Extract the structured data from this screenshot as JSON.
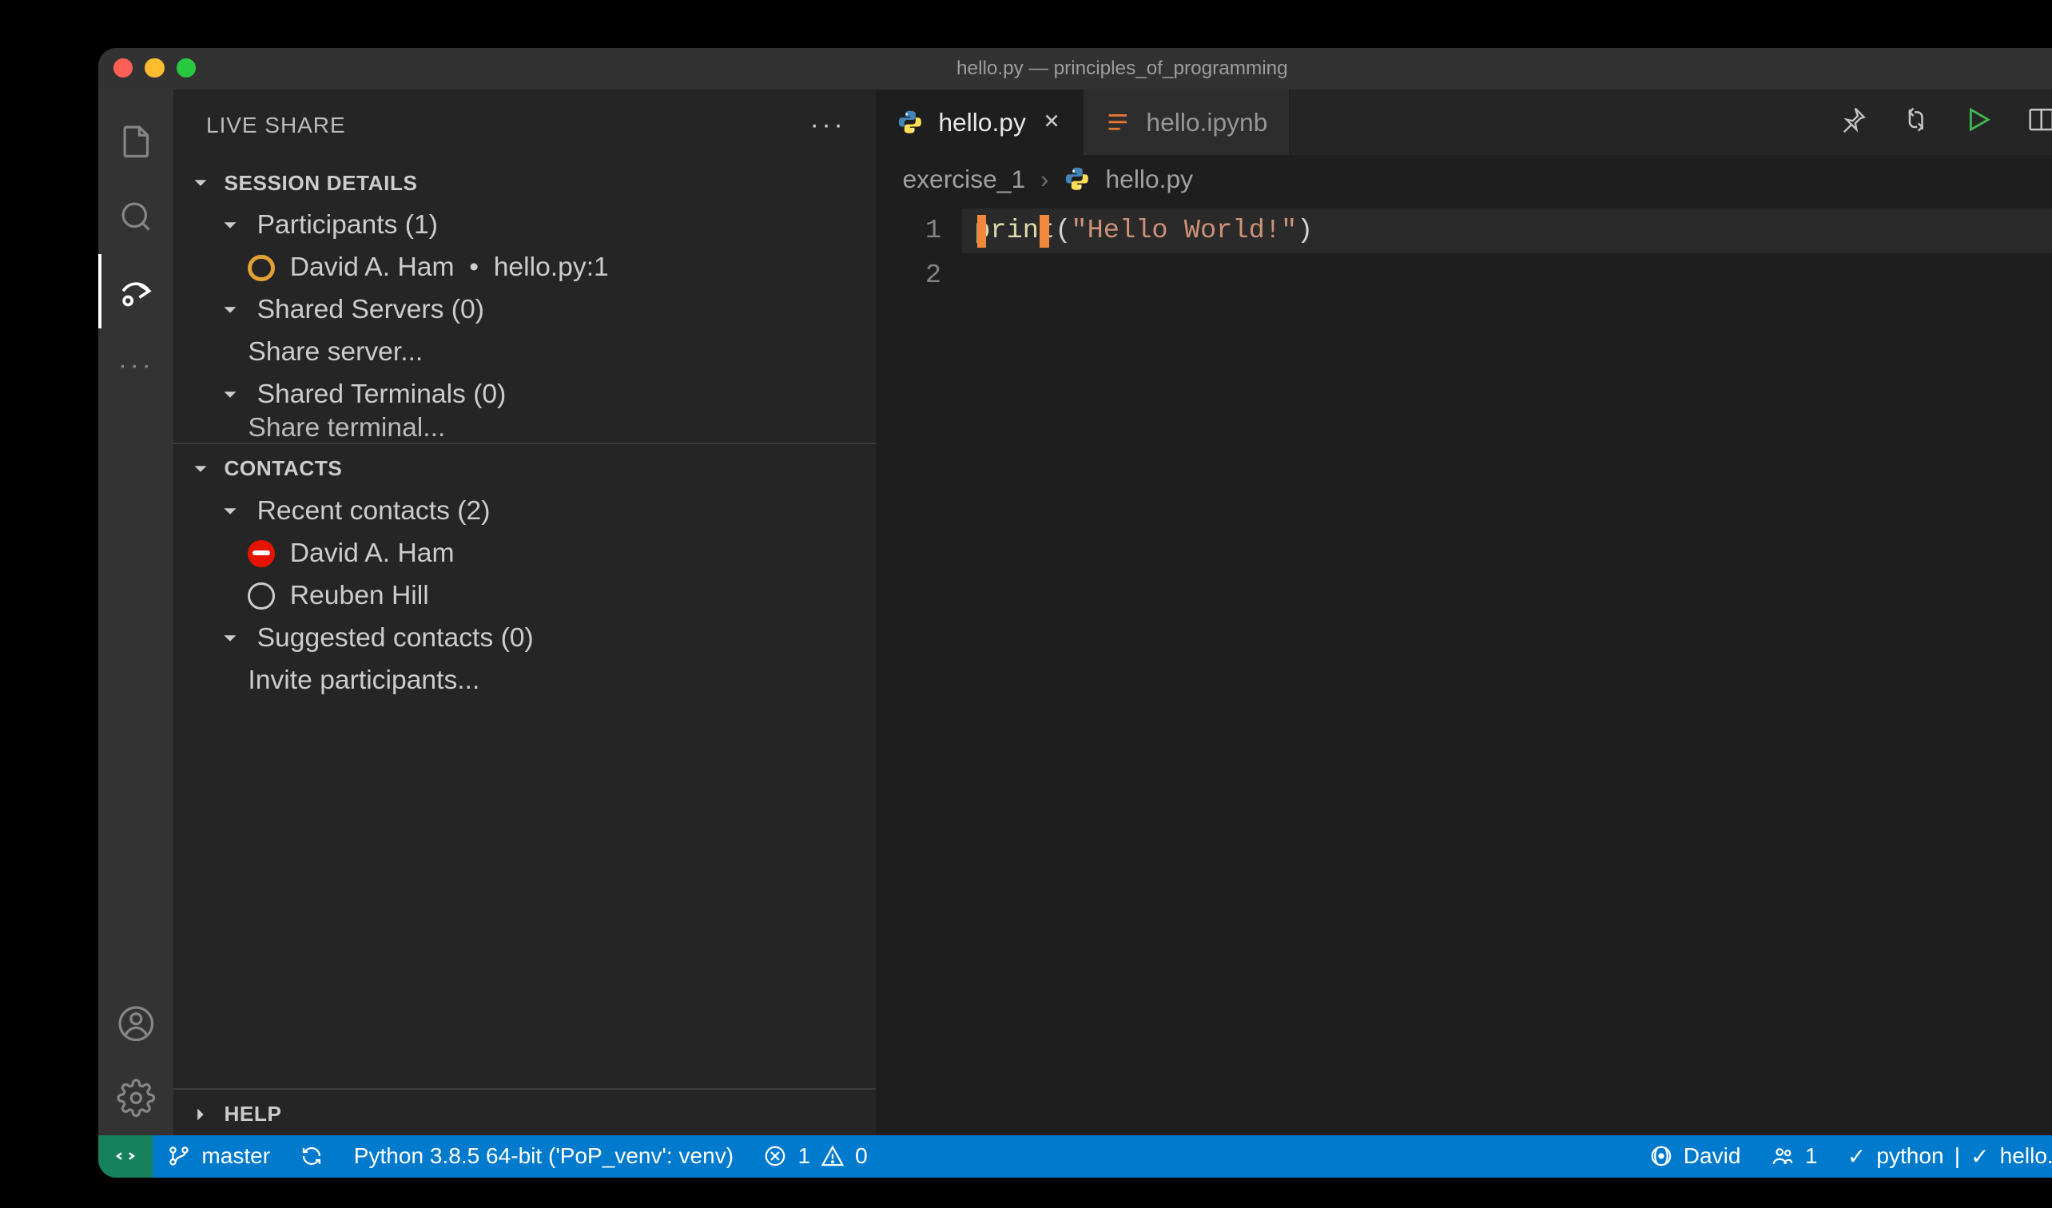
{
  "window": {
    "title": "hello.py — principles_of_programming"
  },
  "sidebar": {
    "title": "LIVE SHARE",
    "sections": {
      "session": {
        "title": "SESSION DETAILS",
        "participants": {
          "label": "Participants (1)",
          "items": [
            {
              "name": "David A. Ham",
              "location": "hello.py:1"
            }
          ]
        },
        "servers": {
          "label": "Shared Servers (0)",
          "action": "Share server..."
        },
        "terminals": {
          "label": "Shared Terminals (0)",
          "action": "Share terminal..."
        }
      },
      "contacts": {
        "title": "CONTACTS",
        "recent": {
          "label": "Recent contacts (2)",
          "items": [
            "David A. Ham",
            "Reuben Hill"
          ]
        },
        "suggested": {
          "label": "Suggested contacts (0)",
          "action": "Invite participants..."
        }
      },
      "help": {
        "title": "HELP"
      }
    }
  },
  "tabs": {
    "active": "hello.py",
    "items": [
      {
        "label": "hello.py",
        "kind": "python",
        "active": true
      },
      {
        "label": "hello.ipynb",
        "kind": "notebook",
        "active": false
      }
    ]
  },
  "breadcrumbs": {
    "folder": "exercise_1",
    "file": "hello.py"
  },
  "code": {
    "lines": [
      {
        "n": "1",
        "fn": "print",
        "open": "(",
        "str": "\"Hello World!\"",
        "close": ")"
      },
      {
        "n": "2"
      }
    ]
  },
  "statusbar": {
    "branch": "master",
    "interpreter": "Python 3.8.5 64-bit ('PoP_venv': venv)",
    "errors": "1",
    "warnings": "0",
    "liveshare_host": "David",
    "participants_count": "1",
    "task1": "python",
    "task2": "hello.py"
  }
}
